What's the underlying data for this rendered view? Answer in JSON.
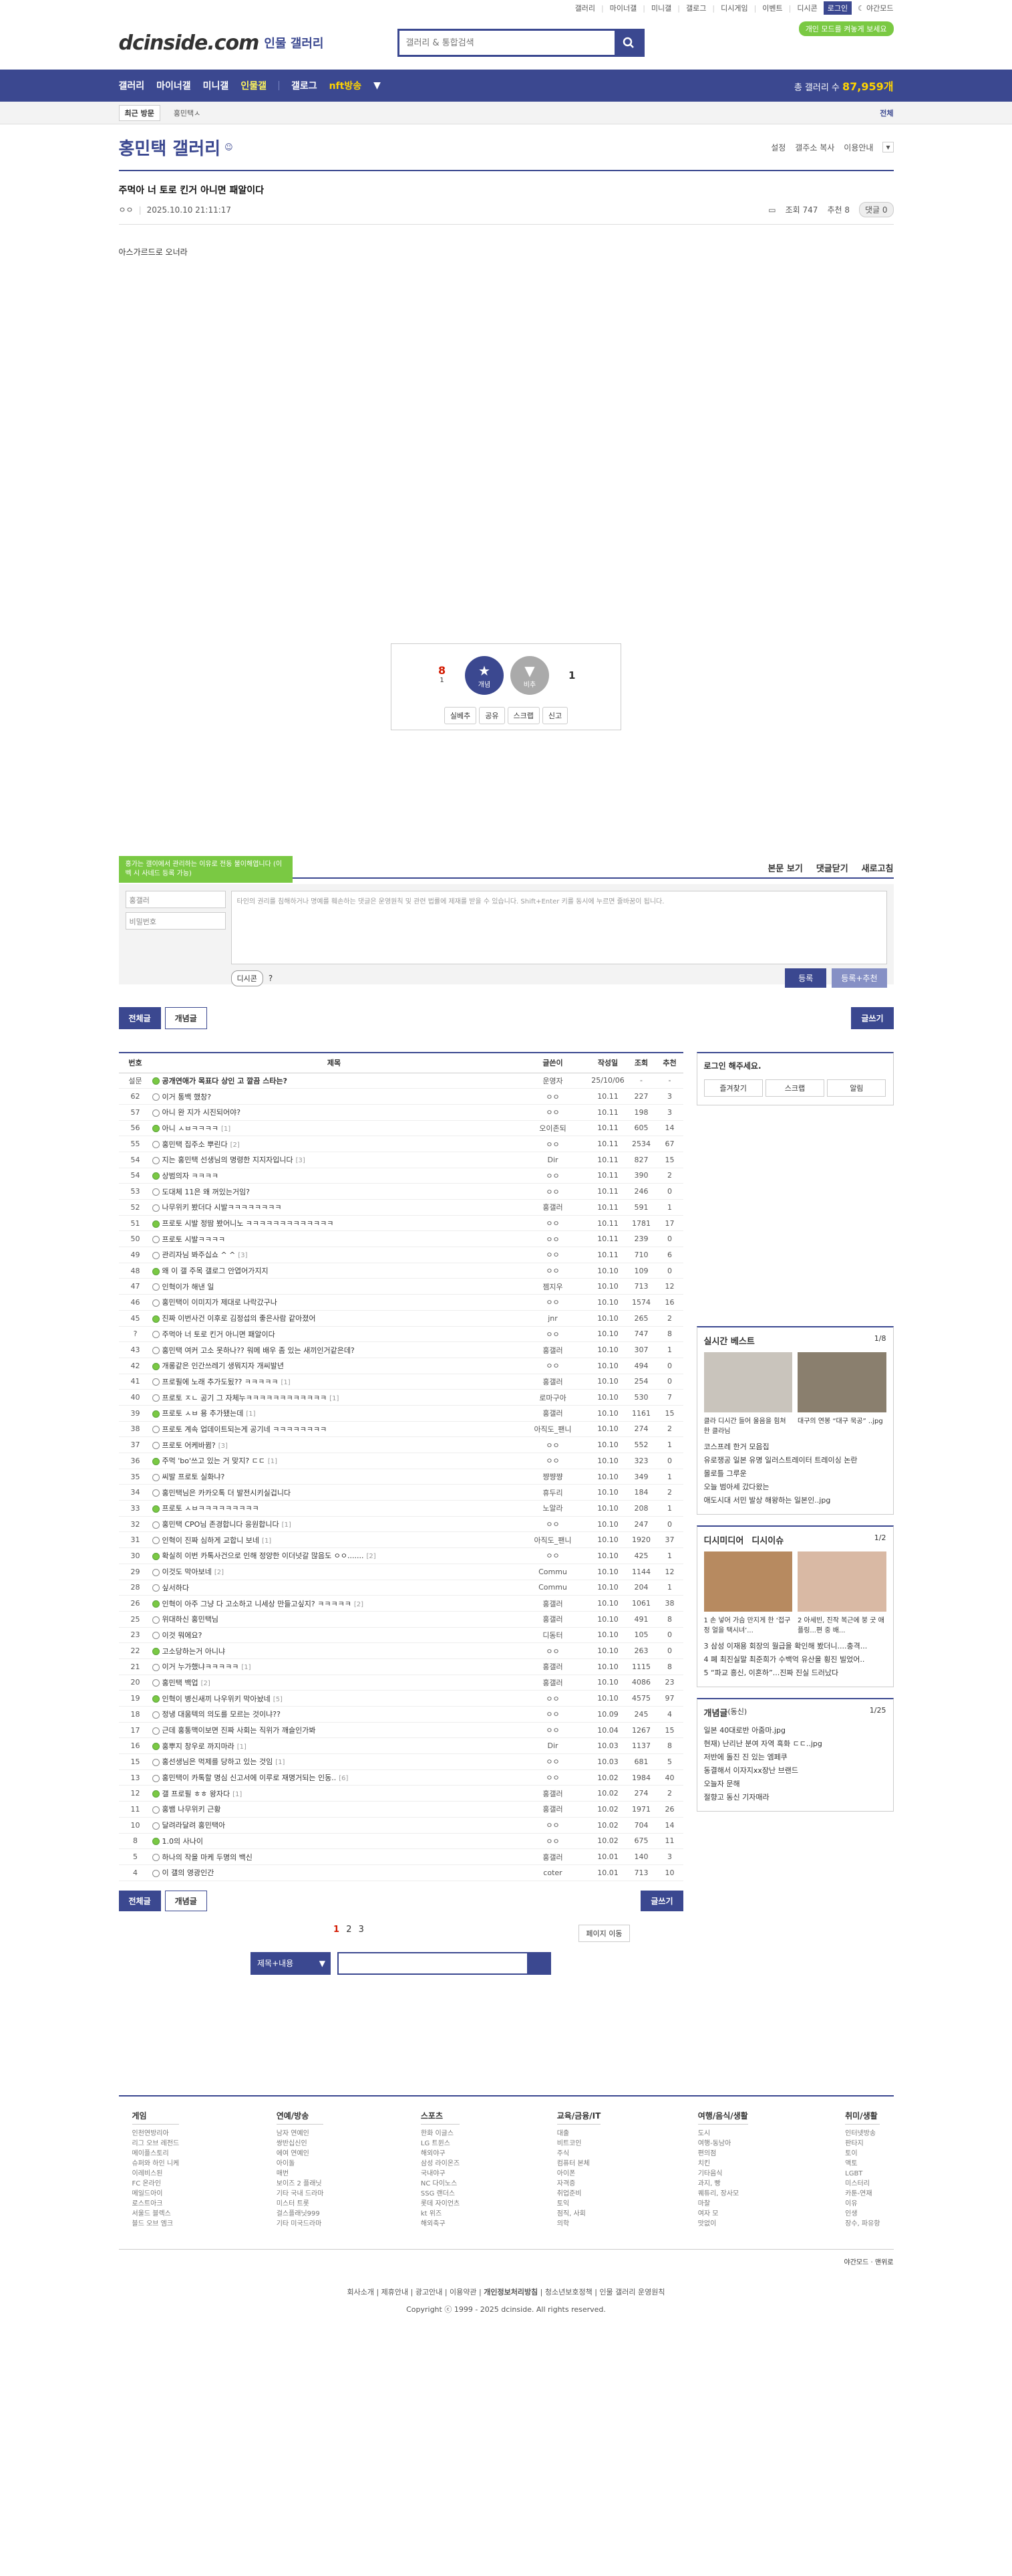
{
  "util": {
    "items": [
      "갤러리",
      "마이너갤",
      "미니갤",
      "갤로그",
      "디시게임",
      "이벤트",
      "디시콘"
    ],
    "login": "로그인",
    "night": "야간모드",
    "dark_btn": "개인 모드를 켜놓게 보세요"
  },
  "logo": {
    "name": "dcinside.com",
    "sub": "인물 갤러리"
  },
  "search": {
    "placeholder": "갤러리 & 통합검색"
  },
  "nav": {
    "items": [
      "갤러리",
      "마이너갤",
      "미니갤",
      "인물갤"
    ],
    "items2": [
      "갤로그",
      "nav_broadcast"
    ],
    "broadcast": "nft방송",
    "total_label": "총 갤러리 수",
    "total_num": "87,959개"
  },
  "recent": {
    "tab": "최근 방문",
    "cur": "홍민택ㅅ",
    "all": "전체"
  },
  "gallery": {
    "title": "홍민택 갤러리",
    "tools": [
      "설정",
      "갤주소 복사",
      "이용안내"
    ]
  },
  "post": {
    "title": "주먹아 너 토로 킨거 아니면 패알이다",
    "author": "ㅇㅇ",
    "date": "2025.10.10 21:11:17",
    "views": "조회 747",
    "rec": "추천 8",
    "cmt": "댓글 0",
    "body": "아스가르드로 오너라"
  },
  "recbox": {
    "up": "8",
    "up_sub": "1",
    "up_btn": "개념",
    "down_btn": "비추",
    "down": "1",
    "btns": [
      "실베추",
      "공유",
      "스크랩",
      "신고"
    ]
  },
  "comment": {
    "tip": "홍가는 갤이에서 관리하는 이유로 전동 불이해엽니다 (이벡 시 사네드 등록 가능)",
    "bar": [
      "본문 보기",
      "댓글닫기",
      "새로고침"
    ],
    "user": "홍갤러",
    "pw": "비밀번호",
    "ta": "타인의 권리를 침해하거나 명예를 훼손하는 댓글은 운영원칙 및 관련 법률에 제재를 받을 수 있습니다. Shift+Enter 키를 동시에 누르면 줄바꿈이 됩니다.",
    "dc": "디시콘",
    "submit": "등록",
    "submit2": "등록+추천"
  },
  "listbtns": {
    "all": "전체글",
    "concept": "개념글",
    "write": "글쓰기"
  },
  "table": {
    "headers": [
      "번호",
      "제목",
      "글쓴이",
      "작성일",
      "조회",
      "추천"
    ],
    "rows": [
      [
        "설문",
        "공개연애가 목표다 상인 고 깔끔 스타는?",
        "",
        "운영자",
        "25/10/06",
        "-",
        "-"
      ],
      [
        "62",
        "이거 통백 했창?",
        "",
        "ㅇㅇ",
        "10.11",
        "227",
        "3"
      ],
      [
        "57",
        "아니 완 지가 시진되어야?",
        "",
        "ㅇㅇ",
        "10.11",
        "198",
        "3"
      ],
      [
        "56",
        "아니 ㅅㅂㅋㅋㅋㅋ",
        "[1]",
        "오이존되",
        "10.11",
        "605",
        "14"
      ],
      [
        "55",
        "홍민택 집주소 뿌린다",
        "[2]",
        "ㅇㅇ",
        "10.11",
        "2534",
        "67"
      ],
      [
        "54",
        "지는 홍민택 선생님의 명령한 지지자입니다",
        "[3]",
        "Dir",
        "10.11",
        "827",
        "15"
      ],
      [
        "54",
        "상범의자 ㅋㅋㅋㅋ",
        "",
        "ㅇㅇ",
        "10.11",
        "390",
        "2"
      ],
      [
        "53",
        "도대체 11은 왜 꺼있는거임?",
        "",
        "ㅇㅇ",
        "10.11",
        "246",
        "0"
      ],
      [
        "52",
        "나무위키 봤더다 시발ㅋㅋㅋㅋㅋㅋㅋㅋ",
        "",
        "홍갤러",
        "10.11",
        "591",
        "1"
      ],
      [
        "51",
        "프로토 시발 정땀 봤어니노 ㅋㅋㅋㅋㅋㅋㅋㅋㅋㅋㅋㅋㅋ",
        "",
        "ㅇㅇ",
        "10.11",
        "1781",
        "17"
      ],
      [
        "50",
        "프로토 시발ㅋㅋㅋㅋ",
        "",
        "ㅇㅇ",
        "10.11",
        "239",
        "0"
      ],
      [
        "49",
        "관리자님 봐주십쇼 ^ ^",
        "[3]",
        "ㅇㅇ",
        "10.11",
        "710",
        "6"
      ],
      [
        "48",
        "왜 이 갤 주목 갤로그 안엽어가지지",
        "",
        "ㅇㅇ",
        "10.10",
        "109",
        "0"
      ],
      [
        "47",
        "인혁이가 해낸 일",
        "",
        "젬지우",
        "10.10",
        "713",
        "12"
      ],
      [
        "46",
        "홍민택이 이미지가 제대로 나락갔구나",
        "",
        "ㅇㅇ",
        "10.10",
        "1574",
        "16"
      ],
      [
        "45",
        "진짜 이번사건 이후로 김정섭의 좋은사람 같아졌어",
        "",
        "jnr",
        "10.10",
        "265",
        "2"
      ],
      [
        "?",
        "주먹아 너 토로 킨거 아니면 패알이다",
        "",
        "ㅇㅇ",
        "10.10",
        "747",
        "8"
      ],
      [
        "43",
        "홍민택 여커 고소 못하나?? 워메 배우 좀 있는 새끼인거같은데?",
        "",
        "홍갤러",
        "10.10",
        "307",
        "1"
      ],
      [
        "42",
        "개롱같은 인간쓰레기 생뭐지자 개씨발년",
        "",
        "ㅇㅇ",
        "10.10",
        "494",
        "0"
      ],
      [
        "41",
        "프로필에 노래 추가도됬?? ㅋㅋㅋㅋㅋ",
        "[1]",
        "홍갤러",
        "10.10",
        "254",
        "0"
      ],
      [
        "40",
        "프로토 ㅈㄴ 공기 그 자체누ㅋㅋㅋㅋㅋㅋㅋㅋㅋㅋㅋㅋ",
        "[1]",
        "로마구아",
        "10.10",
        "530",
        "7"
      ],
      [
        "39",
        "프로토 ㅅㅂ 용 추가됐는데",
        "[1]",
        "홍갤러",
        "10.10",
        "1161",
        "15"
      ],
      [
        "38",
        "프로토 계속 업데이트되는게 공기네 ㅋㅋㅋㅋㅋㅋㅋㅋ",
        "",
        "아직도_팬니",
        "10.10",
        "274",
        "2"
      ],
      [
        "37",
        "프로토 어케바뀜?",
        "[3]",
        "ㅇㅇ",
        "10.10",
        "552",
        "1"
      ],
      [
        "36",
        "주먹 'bo'쓰고 있는 거 맞지? ㄷㄷ",
        "[1]",
        "ㅇㅇ",
        "10.10",
        "323",
        "0"
      ],
      [
        "35",
        "씨발 프로토 실화냐?",
        "",
        "쨩쨩쨩",
        "10.10",
        "349",
        "1"
      ],
      [
        "34",
        "홍민택님은 카카오톡 더 발전시키실겁니다",
        "",
        "휴두리",
        "10.10",
        "184",
        "2"
      ],
      [
        "33",
        "프로토 ㅅㅂㅋㅋㅋㅋㅋㅋㅋㅋㅋ",
        "",
        "노알라",
        "10.10",
        "208",
        "1"
      ],
      [
        "32",
        "홍민택 CPO님 존경합니다 응원합니다",
        "[1]",
        "ㅇㅇ",
        "10.10",
        "247",
        "0"
      ],
      [
        "31",
        "인혁이 진짜 심하게 교합니 보네",
        "[1]",
        "아직도_팬니",
        "10.10",
        "1920",
        "37"
      ],
      [
        "30",
        "확실히 이번 카톡사건으로 인해 정양한 이더넛갈 많음도 ㅇㅇ.......",
        "[2]",
        "ㅇㅇ",
        "10.10",
        "425",
        "1"
      ],
      [
        "29",
        "이것도 막아보네",
        "[2]",
        "Commu",
        "10.10",
        "1144",
        "12"
      ],
      [
        "28",
        "싶서하다",
        "",
        "Commu",
        "10.10",
        "204",
        "1"
      ],
      [
        "26",
        "인혁이 아주 그냥 다 고소하고 니세상 만들고싶지? ㅋㅋㅋㅋㅋ",
        "[2]",
        "홍갤러",
        "10.10",
        "1061",
        "38"
      ],
      [
        "25",
        "위대하신 홍민택님",
        "",
        "홍갤러",
        "10.10",
        "491",
        "8"
      ],
      [
        "23",
        "이것 뭐에요?",
        "",
        "디동터",
        "10.10",
        "105",
        "0"
      ],
      [
        "22",
        "고소당하는거 아니냐",
        "",
        "ㅇㅇ",
        "10.10",
        "263",
        "0"
      ],
      [
        "21",
        "이거 누가했냐ㅋㅋㅋㅋㅋ",
        "[1]",
        "홍갤러",
        "10.10",
        "1115",
        "8"
      ],
      [
        "20",
        "홍민택 백업",
        "[2]",
        "홍갤러",
        "10.10",
        "4086",
        "23"
      ],
      [
        "19",
        "인혁이 병신새끼 나우위키 막아놨네",
        "[5]",
        "ㅇㅇ",
        "10.10",
        "4575",
        "97"
      ],
      [
        "18",
        "정냉 대움텍의 의도를 모르는 것이냐??",
        "",
        "ㅇㅇ",
        "10.09",
        "245",
        "4"
      ],
      [
        "17",
        "근데 홍통맥이보면 진짜 사회는 직위가 깨슬인가봐",
        "",
        "ㅇㅇ",
        "10.04",
        "1267",
        "15"
      ],
      [
        "16",
        "홍뿌지 창우로 까지마라",
        "[1]",
        "Dir",
        "10.03",
        "1137",
        "8"
      ],
      [
        "15",
        "홍선생님은 먹제를 당하고 있는 것임",
        "[1]",
        "ㅇㅇ",
        "10.03",
        "681",
        "5"
      ],
      [
        "13",
        "홍민택이 카톡할 명심 신고서에 이루로 재명거되는 인동..",
        "[6]",
        "ㅇㅇ",
        "10.02",
        "1984",
        "40"
      ],
      [
        "12",
        "갤 프로필 ㅎㅎ 왕자다",
        "[1]",
        "홍갤러",
        "10.02",
        "274",
        "2"
      ],
      [
        "11",
        "홍뱀 나무위키 근황",
        "",
        "홍갤러",
        "10.02",
        "1971",
        "26"
      ],
      [
        "10",
        "달려라달려 홍민택아",
        "",
        "ㅇㅇ",
        "10.02",
        "704",
        "14"
      ],
      [
        "8",
        "1.0의 사나이",
        "",
        "ㅇㅇ",
        "10.02",
        "675",
        "11"
      ],
      [
        "5",
        "하나의 작을 마케 두명의 백신",
        "",
        "홍갤러",
        "10.01",
        "140",
        "3"
      ],
      [
        "4",
        "이 갤의 영광인간",
        "",
        "coter",
        "10.01",
        "713",
        "10"
      ]
    ]
  },
  "pager": {
    "pages": [
      "1",
      "2",
      "3"
    ],
    "next": "페이지 이동"
  },
  "bsearch": {
    "select": "제목+내용"
  },
  "side": {
    "login": "로그인 해주세요.",
    "login_btns": [
      "즐겨찾기",
      "스크랩",
      "알림"
    ],
    "best_title": "실시간 베스트",
    "best_page": "1/8",
    "best_caps": [
      "클라 디시간 들어 울음을 힘쳐 한 클라님",
      "대구의 연봉 “대구 묵공” ..jpg"
    ],
    "best_list": [
      "코스프레 한거 모음집",
      "유로쟁공 일본 유명 일러스트레이터 트레이싱 논란",
      "몰로틀 그루운",
      "오늘 범아세 갔다왔는",
      "애도시대 서민 발상 해왕하는 일본인..jpg"
    ],
    "dm_title": "디시미디어",
    "dm_title2": "디시이슈",
    "dm_page": "1/2",
    "dm_caps": [
      "1 손 넣어 가슴 만지게 한 ‘접구정 얼을 택시녀’...",
      "2 아세빈, 진작 복근에 붕 굿 애플링...편 중 배..."
    ],
    "dm_list": [
      "3 삼성 이재용 회장의 월급을 확인해 봤더니....충격...",
      "4 폐 최진실말 최준희가 수백억 유산을 횡진 빌었어..",
      "5 “파교 흥신, 이혼하”...진짜 진실 드러났다"
    ],
    "cg_title": "개념글",
    "cg_sub": "(동신)",
    "cg_page": "1/25",
    "cg_list": [
      "일본 40대로반 아줌마.jpg",
      "현재) 난리난 분여 자역 흑화 ㄷㄷ..jpg",
      "저반에 돌진 진 있는 엠페쿠",
      "동결해서 이자지xx장난 브랜드",
      "오늘자 문해",
      "절향고 동신 기자매라"
    ]
  },
  "footer": {
    "cols": [
      {
        "h": "게임",
        "items": [
          "인천연방리아",
          "리그 오브 레전드",
          "메이플스토리",
          "슈퍼와 하인 니케",
          "이레비스된",
          "FC 온라인",
          "메일드아이",
          "로스트아크",
          "서울드 블렉스",
          "블드 오브 엠크"
        ]
      },
      {
        "h": "연예/방송",
        "items": [
          "남자 연예인",
          "쌍반십신인",
          "에여 연예인",
          "아이돌",
          "매번",
          "보이즈 2 플래닛",
          "기타 국내 드라마",
          "미스터 트롯",
          "걸스플래닛999",
          "기타 미국드라마"
        ]
      },
      {
        "h": "스포츠",
        "items": [
          "한화 이글스",
          "LG 트윈스",
          "해외야구",
          "삼성 라이온즈",
          "국내야구",
          "NC 다이노스",
          "SSG 랜더스",
          "롯데 자이언츠",
          "kt 위즈",
          "해외축구"
        ]
      },
      {
        "h": "교육/금융/IT",
        "items": [
          "대출",
          "비트코인",
          "주식",
          "컴퓨터 본체",
          "아이폰",
          "자격증",
          "취업준비",
          "토익",
          "점직, 사회",
          "의학"
        ]
      },
      {
        "h": "여행/음식/생활",
        "items": [
          "도시",
          "여행-동남아",
          "편의점",
          "치킨",
          "기타음식",
          "과지, 빵",
          "퀘튜리, 장사모",
          "마찰",
          "여자 모",
          "맛없이"
        ]
      },
      {
        "h": "취미/생활",
        "items": [
          "인터넷방송",
          "판타지",
          "토이",
          "액토",
          "LGBT",
          "미스터리",
          "카툰-연재",
          "이유",
          "인생",
          "장수, 파유항"
        ]
      }
    ],
    "bottom": [
      "야간모드",
      "맨위로"
    ],
    "links": [
      "회사소개",
      "제휴안내",
      "광고안내",
      "이용약관",
      "개인정보처리방침",
      "청소년보호정책",
      "인물 갤러리 운영원칙"
    ],
    "copy": "Copyright ⓒ 1999 - 2025 dcinside. All rights reserved."
  }
}
